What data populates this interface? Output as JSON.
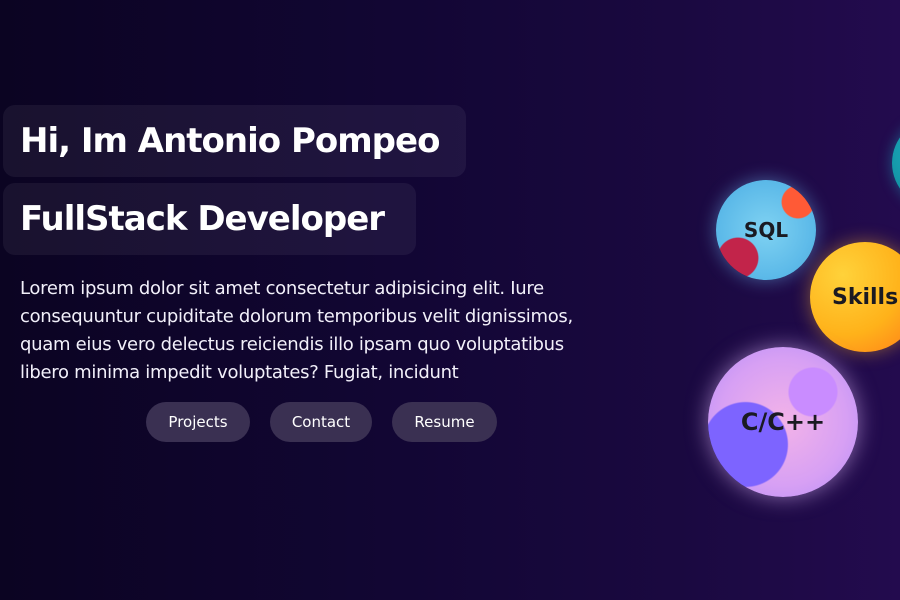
{
  "hero": {
    "greeting": "Hi, Im Antonio Pompeo",
    "role": "FullStack Developer",
    "intro": "Lorem ipsum dolor sit amet consectetur adipisicing elit. Iure consequuntur cupiditate dolorum temporibus velit dignissimos, quam eius vero delectus reiciendis illo ipsam quo voluptatibus libero minima impedit voluptates? Fugiat, incidunt",
    "buttons": {
      "projects": "Projects",
      "contact": "Contact",
      "resume": "Resume"
    }
  },
  "bubbles": {
    "sql": "SQL",
    "skills": "Skills",
    "cpp": "C/C++"
  },
  "colors": {
    "background_start": "#0b0422",
    "background_end": "#230b4e",
    "button_bg": "#3a3052",
    "text": "#ffffff"
  }
}
